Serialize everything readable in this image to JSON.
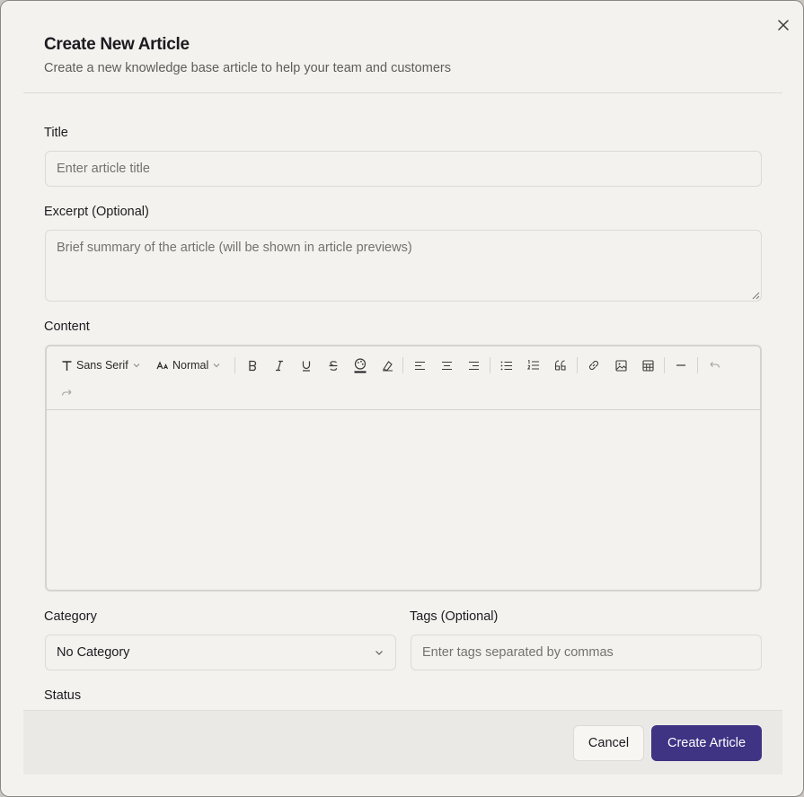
{
  "dialog": {
    "title": "Create New Article",
    "subtitle": "Create a new knowledge base article to help your team and customers"
  },
  "fields": {
    "title": {
      "label": "Title",
      "value": "",
      "placeholder": "Enter article title"
    },
    "excerpt": {
      "label": "Excerpt (Optional)",
      "value": "",
      "placeholder": "Brief summary of the article (will be shown in article previews)"
    },
    "content": {
      "label": "Content",
      "value": ""
    },
    "category": {
      "label": "Category",
      "selected": "No Category"
    },
    "tags": {
      "label": "Tags (Optional)",
      "value": "",
      "placeholder": "Enter tags separated by commas"
    },
    "status": {
      "label": "Status"
    }
  },
  "toolbar": {
    "font": "Sans Serif",
    "size": "Normal",
    "icons": [
      "font-icon",
      "text-size-icon",
      "bold-icon",
      "italic-icon",
      "underline-icon",
      "strikethrough-icon",
      "text-color-icon",
      "clear-format-icon",
      "align-left-icon",
      "align-center-icon",
      "align-right-icon",
      "bullet-list-icon",
      "ordered-list-icon",
      "quote-icon",
      "link-icon",
      "image-icon",
      "table-icon",
      "horizontal-rule-icon",
      "undo-icon",
      "redo-icon"
    ]
  },
  "buttons": {
    "cancel": "Cancel",
    "create": "Create Article"
  },
  "colors": {
    "primary": "#3f3384",
    "background": "#f3f2ef",
    "border": "#dcdad6"
  }
}
